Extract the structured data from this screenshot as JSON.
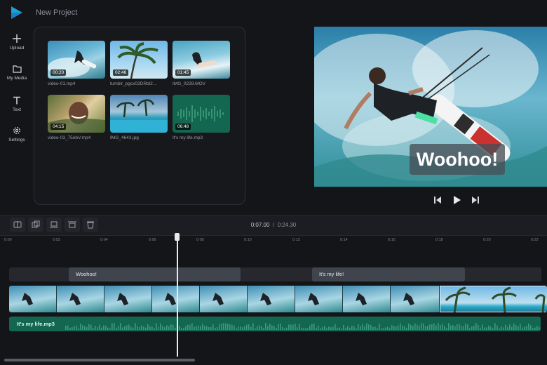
{
  "app": {
    "title": "New Project",
    "logo_icon": "play-logo-icon"
  },
  "sidebar": {
    "items": [
      {
        "icon": "plus-icon",
        "label": "Upload"
      },
      {
        "icon": "folder-icon",
        "label": "My Media"
      },
      {
        "icon": "text-t-icon",
        "label": "Text"
      },
      {
        "icon": "gear-icon",
        "label": "Settings"
      }
    ]
  },
  "media": {
    "items": [
      {
        "name": "video-01.mp4",
        "duration": "00:20"
      },
      {
        "name": "tumblr_pgcx02DRbl2…",
        "duration": "02:46"
      },
      {
        "name": "IMG_0228.MOV",
        "duration": "01:45"
      },
      {
        "name": "video-03_75ebV.mp4",
        "duration": "04:15"
      },
      {
        "name": "IMG_4643.jpg",
        "duration": ""
      },
      {
        "name": "It's my life.mp3",
        "duration": "06:48"
      }
    ]
  },
  "preview": {
    "caption": "Woohoo!"
  },
  "transport": {
    "prev_icon": "skip-back-icon",
    "play_icon": "play-icon",
    "next_icon": "skip-forward-icon"
  },
  "toolbar": {
    "tools": [
      "split-icon",
      "duplicate-icon",
      "align-bottom-icon",
      "align-top-icon",
      "trash-icon"
    ],
    "current_time": "0:07.00",
    "separator": "/",
    "total_time": "0:24.30"
  },
  "timeline": {
    "ticks": [
      "0:00",
      "0:02",
      "0:04",
      "0:06",
      "0:08",
      "0:10",
      "0:12",
      "0:14",
      "0:16",
      "0:18",
      "0:20",
      "0:22"
    ],
    "text_clips": [
      "Woohoo!",
      "It's my life!"
    ],
    "audio_clip": "It's my life.mp3",
    "playhead_time": "0:07.00"
  },
  "colors": {
    "background": "#141519",
    "accent": "#1ba0d8",
    "audio": "#13664f",
    "text_clip": "#40444d"
  }
}
